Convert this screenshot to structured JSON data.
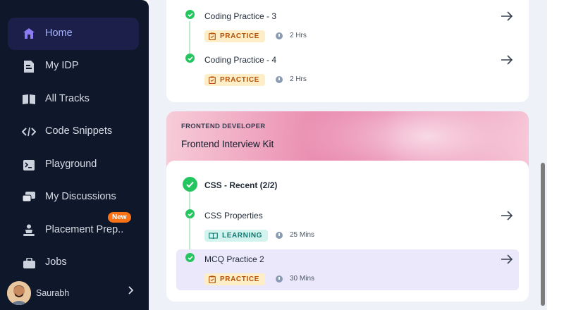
{
  "sidebar": {
    "items": [
      {
        "label": "Home",
        "icon": "home-icon",
        "active": true
      },
      {
        "label": "My IDP",
        "icon": "document-icon"
      },
      {
        "label": "All Tracks",
        "icon": "book-icon"
      },
      {
        "label": "Code Snippets",
        "icon": "code-icon"
      },
      {
        "label": "Playground",
        "icon": "terminal-icon"
      },
      {
        "label": "My Discussions",
        "icon": "chat-icon"
      },
      {
        "label": "Placement Prep..",
        "icon": "person-icon"
      },
      {
        "label": "Jobs",
        "icon": "briefcase-icon"
      }
    ],
    "new_badge": "New",
    "profile": {
      "name": "Saurabh"
    }
  },
  "top_card": {
    "items": [
      {
        "title": "Coding Practice - 3",
        "tag": "PRACTICE",
        "duration": "2 Hrs"
      },
      {
        "title": "Coding Practice - 4",
        "tag": "PRACTICE",
        "duration": "2 Hrs"
      }
    ]
  },
  "banner": {
    "eyebrow": "FRONTEND DEVELOPER",
    "title": "Frontend Interview Kit"
  },
  "bottom_card": {
    "section_title": "CSS - Recent (2/2)",
    "items": [
      {
        "title": "CSS Properties",
        "tag": "LEARNING",
        "duration": "25 Mins"
      },
      {
        "title": "MCQ Practice 2",
        "tag": "PRACTICE",
        "duration": "30 Mins"
      }
    ]
  },
  "colors": {
    "sidebar_bg": "#0f172a",
    "active_bg": "#1c1f4a",
    "active_text": "#a5b4fc",
    "success": "#22c55e",
    "practice_tag": "#fdeec7",
    "learning_tag": "#d3f3ee"
  }
}
